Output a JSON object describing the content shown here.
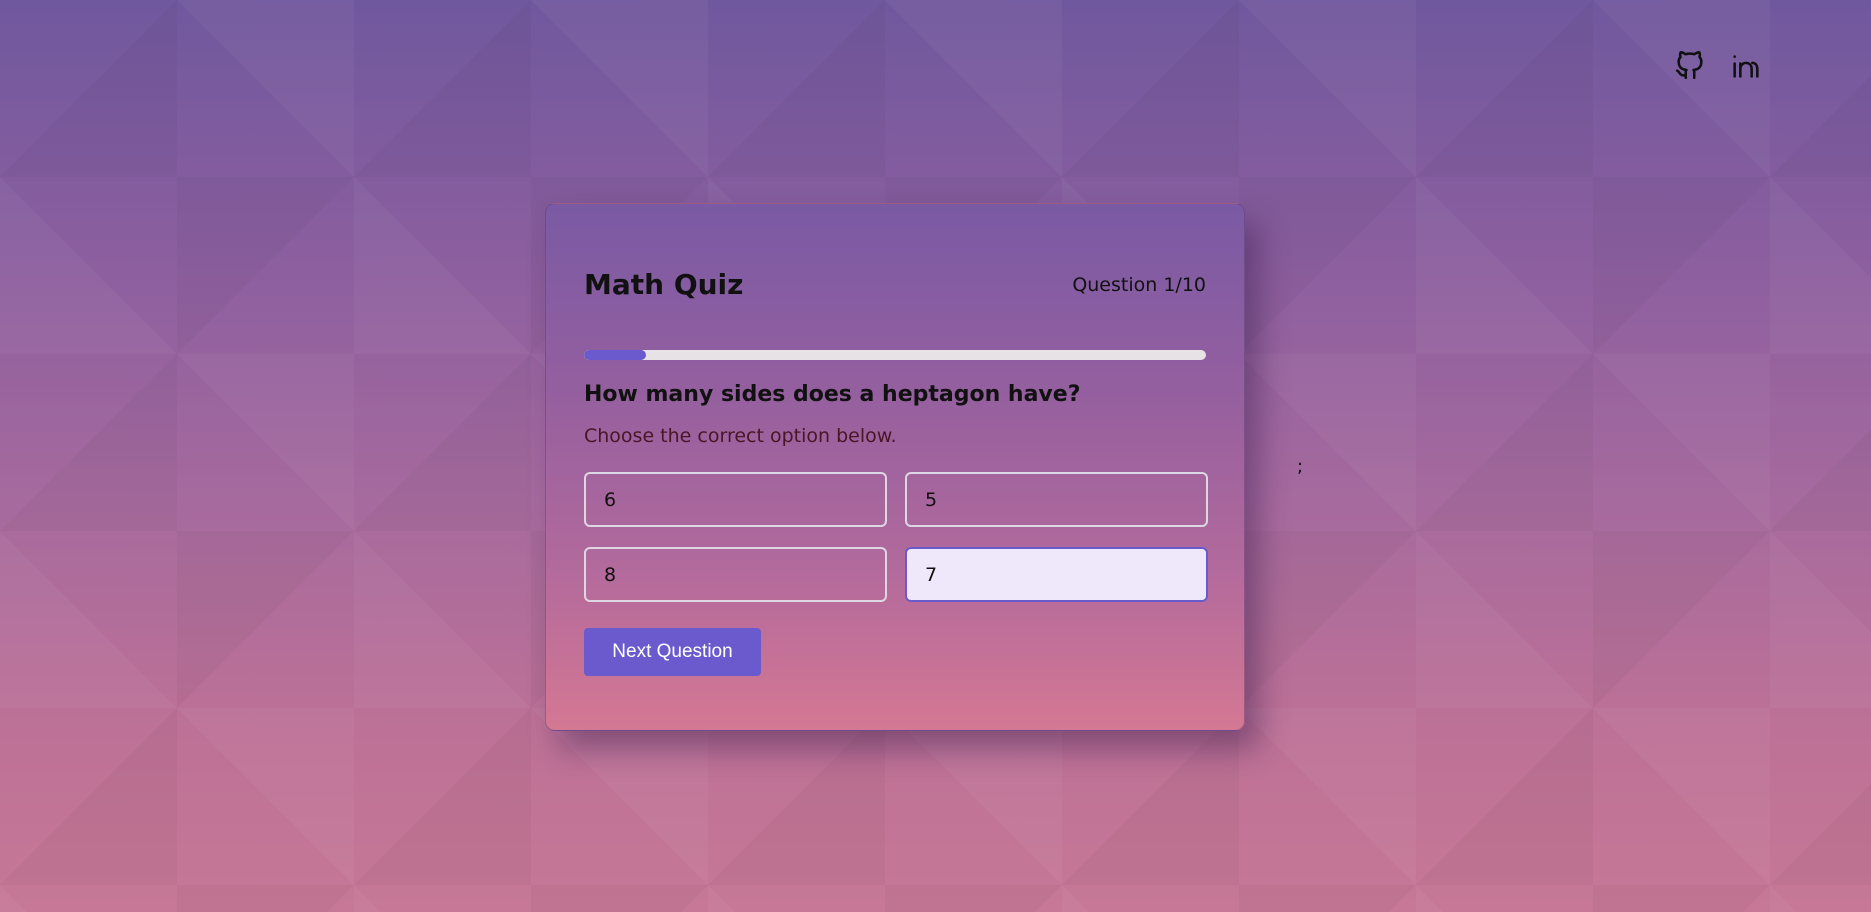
{
  "social": {
    "github_icon": "github-icon",
    "linkedin_icon": "linkedin-icon"
  },
  "quiz": {
    "title": "Math Quiz",
    "counter": "Question 1/10",
    "progress_fraction": 0.1,
    "question": "How many sides does a heptagon have?",
    "instruction": "Choose the correct option below.",
    "options": [
      {
        "label": "6",
        "selected": false
      },
      {
        "label": "5",
        "selected": false
      },
      {
        "label": "8",
        "selected": false
      },
      {
        "label": "7",
        "selected": true
      }
    ],
    "next_label": "Next Question"
  },
  "stray_text": ";",
  "colors": {
    "accent": "#6a5acd",
    "selected_bg": "#efe8fb"
  }
}
